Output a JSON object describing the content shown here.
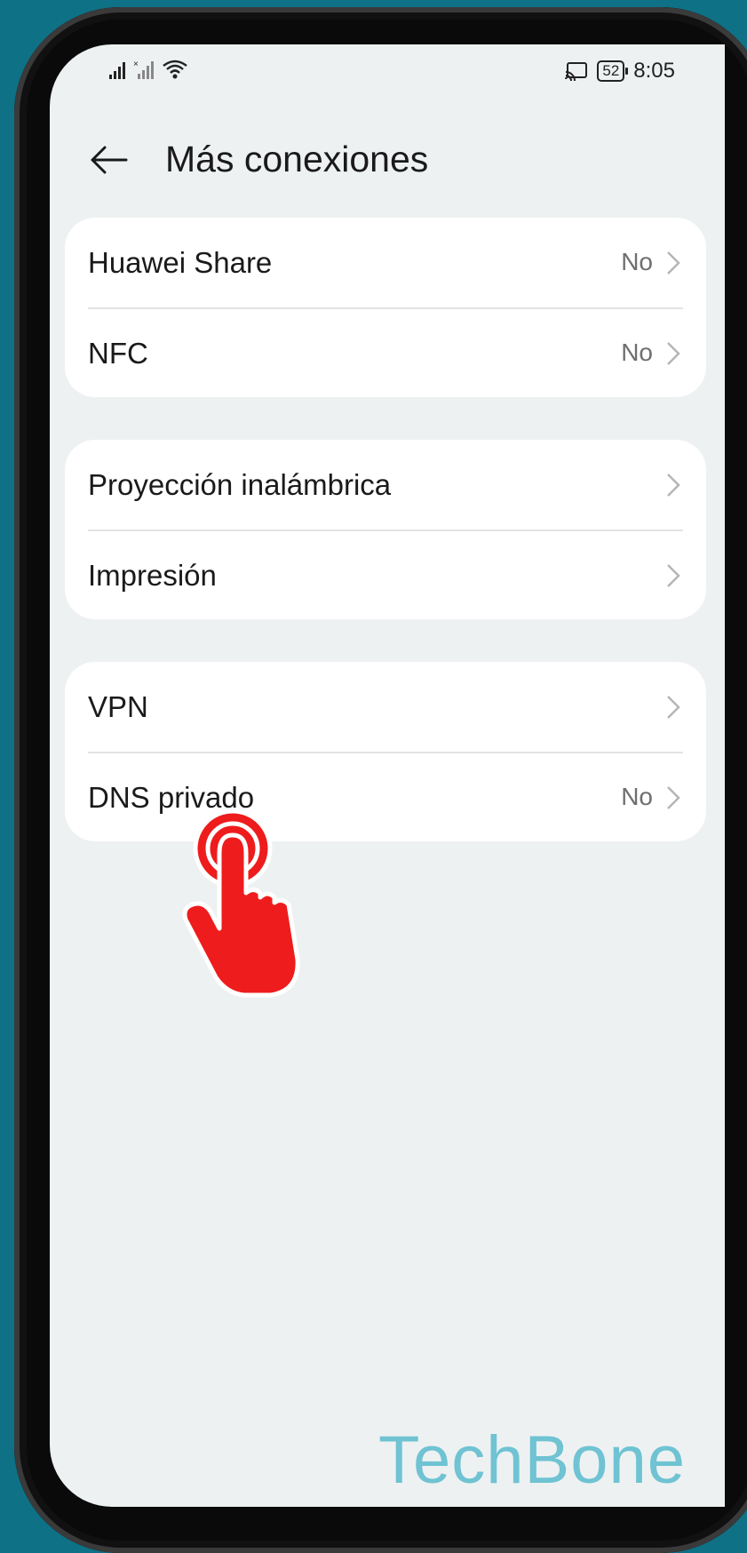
{
  "status_bar": {
    "time": "8:05",
    "battery": "52",
    "icons": [
      "signal-icon",
      "signal-x-icon",
      "wifi-icon",
      "cast-icon",
      "battery-icon"
    ]
  },
  "header": {
    "title": "Más conexiones",
    "back_icon": "arrow-left-icon"
  },
  "groups": [
    {
      "items": [
        {
          "label": "Huawei Share",
          "value": "No"
        },
        {
          "label": "NFC",
          "value": "No"
        }
      ]
    },
    {
      "items": [
        {
          "label": "Proyección inalámbrica",
          "value": ""
        },
        {
          "label": "Impresión",
          "value": ""
        }
      ]
    },
    {
      "items": [
        {
          "label": "VPN",
          "value": ""
        },
        {
          "label": "DNS privado",
          "value": "No"
        }
      ]
    }
  ],
  "overlay": {
    "tap_icon": "tap-hand-icon",
    "accent": "#ee1c1c"
  },
  "watermark": "TechBone",
  "colors": {
    "background": "#0f7186",
    "screen": "#eef1f2",
    "card": "#ffffff",
    "watermark": "#6fc3d3"
  }
}
